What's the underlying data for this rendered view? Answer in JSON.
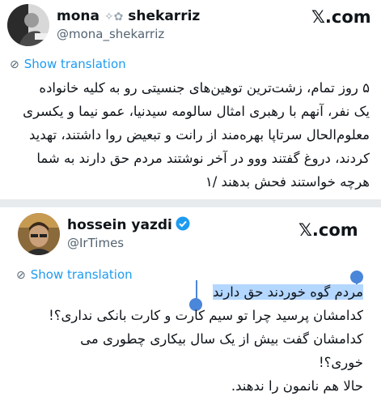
{
  "tweets": [
    {
      "name": "mona",
      "name_suffix": "shekarriz",
      "handle": "@mona_shekarriz",
      "brand": "𝕏.com",
      "show_translation": "Show translation",
      "lines": [
        "۵ روز تمام، زشت‌ترین توهین‌های جنسیتی رو به کلیه خانواده",
        "یک نفر، آنهم با رهبری امثال سالومه سیدنیا، عمو نیما و یکسری",
        "معلوم‌الحال سرتاپا بهره‌مند از رانت و تبعیض روا داشتند، تهدید",
        "کردند، دروغ گفتند ووو در آخر نوشتند مردم حق دارند به شما",
        "هرچه خواستند فحش بدهند /۱"
      ]
    },
    {
      "name": "hossein yazdi",
      "handle": "@IrTimes",
      "brand": "𝕏.com",
      "show_translation": "Show translation",
      "verified": true,
      "lines": [
        "مردم گوه خوردند حق دارند",
        "کدامشان پرسید چرا تو سیم کارت و کارت بانکی نداری؟!",
        "کدامشان گفت بیش از یک سال بیکاری چطوری می",
        "خوری؟!",
        "حالا هم نانمون را ندهند."
      ]
    }
  ],
  "colors": {
    "link": "#1d9bf0",
    "muted": "#536471",
    "selection": "#b4d7ff",
    "handle": "#4a86d9"
  }
}
